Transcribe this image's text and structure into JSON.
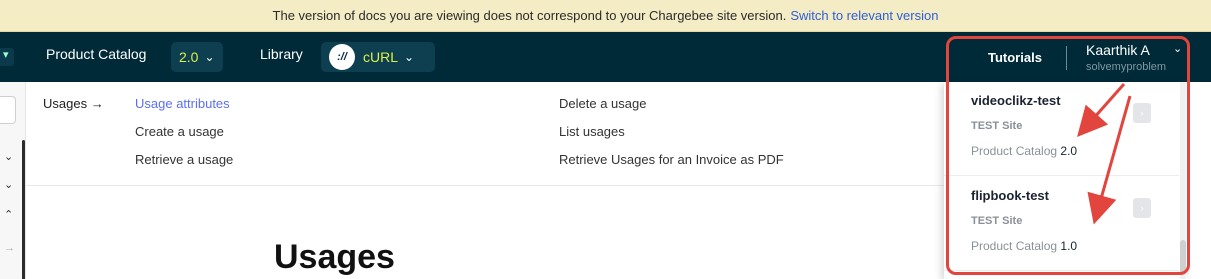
{
  "banner": {
    "message": "The version of docs you are viewing does not correspond to your Chargebee site version.",
    "link": "Switch to relevant version"
  },
  "nav": {
    "product_catalog_label": "Product Catalog",
    "product_catalog_version": "2.0",
    "library_label": "Library",
    "library_value": "cURL",
    "library_icon": "curl-logo-icon",
    "tutorials": "Tutorials",
    "user_name": "Kaarthik A",
    "user_site": "solvemyproblem"
  },
  "submenu": {
    "title": "Usages →",
    "col1": [
      "Usage attributes",
      "Create a usage",
      "Retrieve a usage"
    ],
    "col2": [
      "Delete a usage",
      "List usages",
      "Retrieve Usages for an Invoice as PDF"
    ],
    "active": "Usage attributes"
  },
  "page": {
    "heading": "Usages"
  },
  "sites": [
    {
      "name": "videoclikz-test",
      "type": "TEST Site",
      "catalog_label": "Product Catalog",
      "catalog_version": "2.0"
    },
    {
      "name": "flipbook-test",
      "type": "TEST Site",
      "catalog_label": "Product Catalog",
      "catalog_version": "1.0"
    }
  ],
  "colors": {
    "nav_bg": "#012a38",
    "banner_bg": "#f4ecc4",
    "accent_version": "#d8f04a",
    "link_blue": "#2f5fd6",
    "active_link": "#5b6ff0",
    "annotation_red": "#e2453d"
  }
}
